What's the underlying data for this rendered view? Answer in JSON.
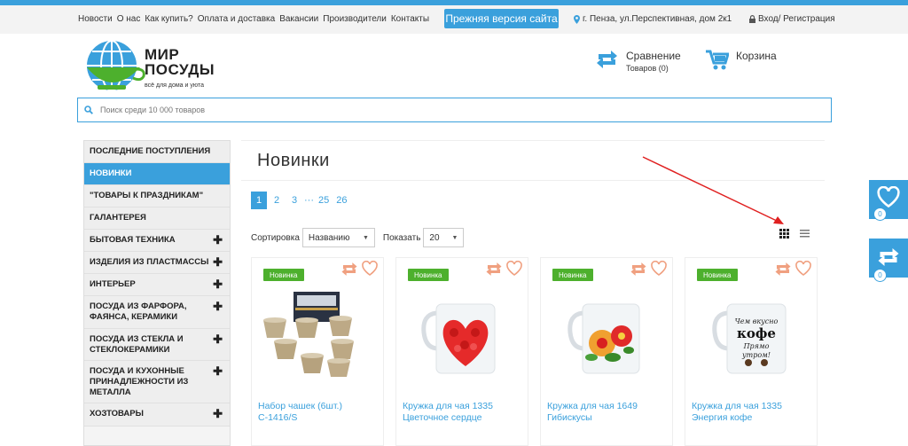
{
  "topbar": {
    "nav": [
      "Новости",
      "О нас",
      "Как купить?",
      "Оплата и доставка",
      "Вакансии",
      "Производители",
      "Контакты"
    ],
    "old_site_label": "Прежняя версия сайта",
    "address": "г. Пенза, ул.Перспективная, дом 2к1",
    "login": "Вход/ Регистрация"
  },
  "logo": {
    "line1": "МИР",
    "line2": "ПОСУДЫ",
    "tagline": "всё для дома и уюта"
  },
  "compare": {
    "title": "Сравнение",
    "count": "Товаров (0)"
  },
  "cart": {
    "title": "Корзина"
  },
  "search": {
    "placeholder": "Поиск среди 10 000 товаров"
  },
  "sidebar": {
    "items": [
      {
        "label": "ПОСЛЕДНИЕ ПОСТУПЛЕНИЯ",
        "plus": "",
        "active": false
      },
      {
        "label": "НОВИНКИ",
        "plus": "",
        "active": true
      },
      {
        "label": "\"ТОВАРЫ К ПРАЗДНИКАМ\"",
        "plus": "",
        "active": false
      },
      {
        "label": "ГАЛАНТЕРЕЯ",
        "plus": "",
        "active": false
      },
      {
        "label": "БЫТОВАЯ ТЕХНИКА",
        "plus": "✚",
        "active": false
      },
      {
        "label": "ИЗДЕЛИЯ ИЗ ПЛАСТМАССЫ",
        "plus": "✚",
        "active": false
      },
      {
        "label": "ИНТЕРЬЕР",
        "plus": "✚",
        "active": false
      },
      {
        "label": "ПОСУДА ИЗ ФАРФОРА, ФАЯНСА, КЕРАМИКИ",
        "plus": "✚",
        "active": false
      },
      {
        "label": "ПОСУДА ИЗ СТЕКЛА И СТЕКЛОКЕРАМИКИ",
        "plus": "✚",
        "active": false
      },
      {
        "label": "ПОСУДА И КУХОННЫЕ ПРИНАДЛЕЖНОСТИ ИЗ МЕТАЛЛА",
        "plus": "✚",
        "active": false
      },
      {
        "label": "ХОЗТОВАРЫ",
        "plus": "✚",
        "active": false
      }
    ]
  },
  "main": {
    "title": "Новинки",
    "pages": [
      "1",
      "2",
      "3",
      "···",
      "25",
      "26"
    ],
    "sort_label": "Сортировка",
    "sort_value": "Названию",
    "show_label": "Показать",
    "show_value": "20"
  },
  "products": [
    {
      "badge": "Новинка",
      "name": "Набор чашек (6шт.) С-1416/S"
    },
    {
      "badge": "Новинка",
      "name": "Кружка для чая 1335 Цветочное сердце"
    },
    {
      "badge": "Новинка",
      "name": "Кружка для чая 1649 Гибискусы"
    },
    {
      "badge": "Новинка",
      "name": "Кружка для чая 1335 Энергия кофе"
    }
  ],
  "mug_text": {
    "line1": "Чем вкусно",
    "line2": "кофе",
    "line3": "Прямо",
    "line4": "утром!"
  },
  "floating": {
    "favorites_count": "0",
    "compare_count": "0"
  },
  "colors": {
    "accent": "#3aa0dc",
    "badge": "#4db02d",
    "icon_orange": "#f0a080",
    "annotation": "#e02020"
  },
  "icons": {
    "location": "map-pin-icon",
    "lock": "lock-icon",
    "compare": "compare-icon",
    "cart": "cart-icon",
    "search": "search-icon",
    "grid": "grid-view-icon",
    "list": "list-view-icon",
    "heart": "heart-icon"
  }
}
